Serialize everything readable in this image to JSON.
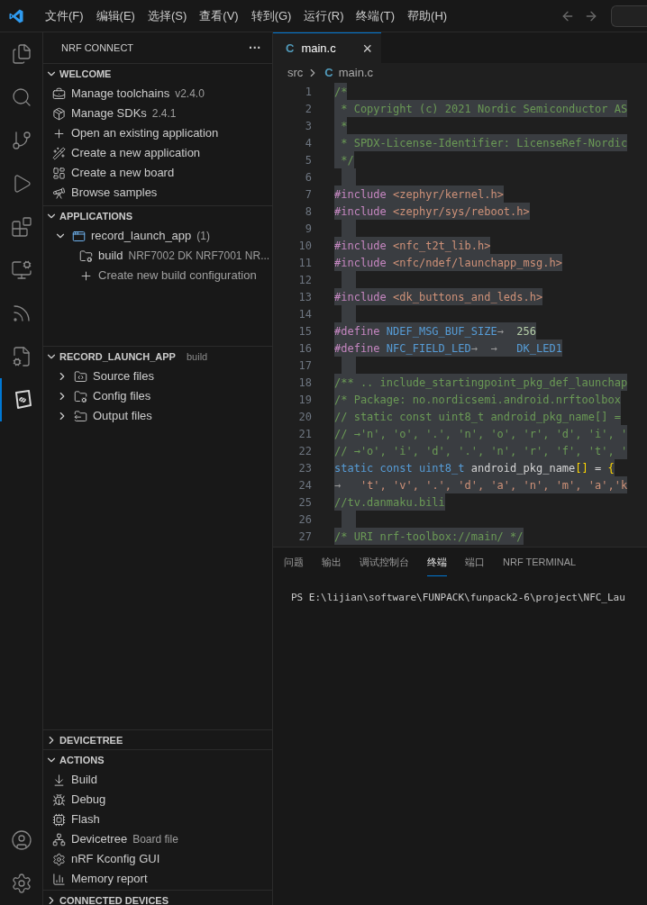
{
  "menu": [
    "文件(F)",
    "编辑(E)",
    "选择(S)",
    "查看(V)",
    "转到(G)",
    "运行(R)",
    "终端(T)",
    "帮助(H)"
  ],
  "sidebar": {
    "title": "NRF CONNECT",
    "more": "···",
    "sections": [
      {
        "title": "WELCOME",
        "expanded": true,
        "items": [
          {
            "label": "Manage toolchains",
            "detail": "v2.4.0"
          },
          {
            "label": "Manage SDKs",
            "detail": "2.4.1"
          },
          {
            "label": "Open an existing application"
          },
          {
            "label": "Create a new application"
          },
          {
            "label": "Create a new board"
          },
          {
            "label": "Browse samples"
          }
        ]
      },
      {
        "title": "APPLICATIONS",
        "expanded": true,
        "items": [
          {
            "label": "record_launch_app",
            "detail": "(1)",
            "expanded": true,
            "children": [
              {
                "label": "build",
                "detail": "NRF7002 DK NRF7001 NR..."
              },
              {
                "label": "Create new build configuration",
                "dim": true
              }
            ]
          }
        ]
      },
      {
        "title": "RECORD_LAUNCH_APP",
        "detail": "build",
        "expanded": true,
        "items": [
          {
            "label": "Source files",
            "expanded": false
          },
          {
            "label": "Config files",
            "expanded": false
          },
          {
            "label": "Output files",
            "expanded": false
          }
        ]
      },
      {
        "title": "DEVICETREE",
        "expanded": false
      },
      {
        "title": "ACTIONS",
        "expanded": true,
        "items": [
          {
            "label": "Build"
          },
          {
            "label": "Debug"
          },
          {
            "label": "Flash"
          },
          {
            "label": "Devicetree",
            "detail": "Board file"
          },
          {
            "label": "nRF Kconfig GUI"
          },
          {
            "label": "Memory report"
          }
        ]
      },
      {
        "title": "CONNECTED DEVICES",
        "expanded": false
      }
    ]
  },
  "editor": {
    "tabs": [
      {
        "icon": "C",
        "label": "main.c",
        "selected": true,
        "close": "×"
      }
    ],
    "breadcrumb": [
      {
        "label": "src"
      },
      {
        "icon": "C",
        "label": "main.c"
      }
    ],
    "lines": [
      {
        "number": "1",
        "selected": true,
        "tokens": [
          {
            "kind": "comment",
            "text": "/*"
          }
        ]
      },
      {
        "number": "2",
        "selected": true,
        "tokens": [
          {
            "kind": "comment",
            "text": " * Copyright (c) 2021 Nordic Semiconductor AS"
          }
        ]
      },
      {
        "number": "3",
        "selected": true,
        "tokens": [
          {
            "kind": "comment",
            "text": " *"
          }
        ]
      },
      {
        "number": "4",
        "selected": true,
        "tokens": [
          {
            "kind": "comment",
            "text": " * SPDX-License-Identifier: LicenseRef-Nordic"
          }
        ]
      },
      {
        "number": "5",
        "selected": true,
        "tokens": [
          {
            "kind": "comment",
            "text": " */"
          }
        ]
      },
      {
        "number": "6",
        "selected": true
      },
      {
        "number": "7",
        "selected": true,
        "tokens": [
          {
            "kind": "directive",
            "text": "#include "
          },
          {
            "kind": "string",
            "text": "<zephyr/kernel.h>"
          }
        ]
      },
      {
        "number": "8",
        "selected": true,
        "tokens": [
          {
            "kind": "directive",
            "text": "#include "
          },
          {
            "kind": "string",
            "text": "<zephyr/sys/reboot.h>"
          }
        ]
      },
      {
        "number": "9",
        "selected": true
      },
      {
        "number": "10",
        "selected": true,
        "tokens": [
          {
            "kind": "directive",
            "text": "#include "
          },
          {
            "kind": "string",
            "text": "<nfc_t2t_lib.h>"
          }
        ]
      },
      {
        "number": "11",
        "selected": true,
        "tokens": [
          {
            "kind": "directive",
            "text": "#include "
          },
          {
            "kind": "string",
            "text": "<nfc/ndef/launchapp_msg.h>"
          }
        ]
      },
      {
        "number": "12",
        "selected": true
      },
      {
        "number": "13",
        "selected": true,
        "tokens": [
          {
            "kind": "directive",
            "text": "#include "
          },
          {
            "kind": "string",
            "text": "<dk_buttons_and_leds.h>"
          }
        ]
      },
      {
        "number": "14",
        "selected": true
      },
      {
        "number": "15",
        "selected": true,
        "tokens": [
          {
            "kind": "directive",
            "text": "#define "
          },
          {
            "kind": "macro",
            "text": "NDEF_MSG_BUF_SIZE"
          },
          {
            "kind": "whitespace",
            "text": "→  "
          },
          {
            "kind": "number",
            "text": "256"
          }
        ]
      },
      {
        "number": "16",
        "selected": true,
        "tokens": [
          {
            "kind": "directive",
            "text": "#define "
          },
          {
            "kind": "macro",
            "text": "NFC_FIELD_LED"
          },
          {
            "kind": "whitespace",
            "text": "→  →   "
          },
          {
            "kind": "macro",
            "text": "DK_LED1"
          }
        ]
      },
      {
        "number": "17",
        "selected": true
      },
      {
        "number": "18",
        "selected": true,
        "tokens": [
          {
            "kind": "comment",
            "text": "/** .. include_startingpoint_pkg_def_launchap"
          }
        ]
      },
      {
        "number": "19",
        "selected": true,
        "tokens": [
          {
            "kind": "comment",
            "text": "/* Package: no.nordicsemi.android.nrftoolbox"
          }
        ]
      },
      {
        "number": "20",
        "selected": true,
        "tokens": [
          {
            "kind": "comment",
            "text": "// static const uint8_t android_pkg_name[] ="
          }
        ]
      },
      {
        "number": "21",
        "selected": true,
        "tokens": [
          {
            "kind": "comment",
            "text": "// →'n', 'o', '.', 'n', 'o', 'r', 'd', 'i', '"
          }
        ]
      },
      {
        "number": "22",
        "selected": true,
        "tokens": [
          {
            "kind": "comment",
            "text": "// →'o', 'i', 'd', '.', 'n', 'r', 'f', 't', '"
          }
        ]
      },
      {
        "number": "23",
        "selected": true,
        "tokens": [
          {
            "kind": "keyword",
            "text": "static const uint8_t"
          },
          {
            "kind": "plain",
            "text": " android_pkg_name"
          },
          {
            "kind": "bracket",
            "text": "[]"
          },
          {
            "kind": "plain",
            "text": " = "
          },
          {
            "kind": "bracket",
            "text": "{"
          }
        ]
      },
      {
        "number": "24",
        "selected": true,
        "tokens": [
          {
            "kind": "whitespace",
            "text": "→   "
          },
          {
            "kind": "string",
            "text": "'t', 'v', '.', 'd', 'a', 'n', 'm', 'a','k"
          }
        ]
      },
      {
        "number": "25",
        "selected": true,
        "tokens": [
          {
            "kind": "comment",
            "text": "//tv.danmaku.bili"
          }
        ]
      },
      {
        "number": "26",
        "selected": true
      },
      {
        "number": "27",
        "selected": true,
        "tokens": [
          {
            "kind": "comment",
            "text": "/* URI nrf-toolbox://main/ */"
          }
        ]
      }
    ]
  },
  "panel": {
    "tabs": [
      {
        "label": "问题",
        "selected": false
      },
      {
        "label": "输出",
        "selected": false
      },
      {
        "label": "调试控制台",
        "selected": false
      },
      {
        "label": "终端",
        "selected": true
      },
      {
        "label": "端口",
        "selected": false
      },
      {
        "label": "NRF TERMINAL",
        "selected": false
      }
    ],
    "terminal": "PS E:\\lijian\\software\\FUNPACK\\funpack2-6\\project\\NFC_Lau"
  }
}
